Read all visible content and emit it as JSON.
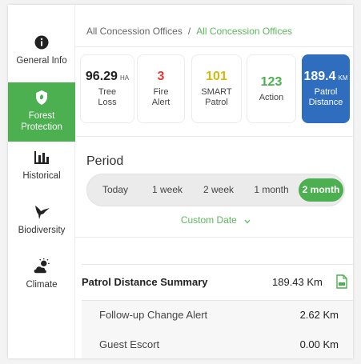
{
  "colors": {
    "accent_green": "#4caf50",
    "patrol_blue": "#2f6dbf",
    "fire_red": "#e53935",
    "smart_yellow": "#d4b80a",
    "action_green": "#4caf50"
  },
  "sidebar": {
    "items": [
      {
        "label": "General Info",
        "icon": "info-icon",
        "active": false
      },
      {
        "label": "Forest\nProtection",
        "icon": "shield-icon",
        "active": true
      },
      {
        "label": "Historical",
        "icon": "bar-chart-icon",
        "active": false
      },
      {
        "label": "Biodiversity",
        "icon": "hummingbird-icon",
        "active": false
      },
      {
        "label": "Climate",
        "icon": "weather-icon",
        "active": false
      }
    ]
  },
  "breadcrumb": {
    "first": "All Concession Offices",
    "separator": "/",
    "second": "All Concession Offices"
  },
  "stats": [
    {
      "value": "96.29",
      "unit": "HA",
      "label": "Tree\nLoss",
      "color": "#222222"
    },
    {
      "value": "3",
      "unit": "",
      "label": "Fire\nAlert",
      "color": "#e53935"
    },
    {
      "value": "101",
      "unit": "",
      "label": "SMART\nPatrol",
      "color": "#d4b80a"
    },
    {
      "value": "123",
      "unit": "",
      "label": "Action",
      "color": "#4caf50"
    },
    {
      "value": "189.4",
      "unit": "KM",
      "label": "Patrol\nDistance",
      "color": "#ffffff"
    }
  ],
  "period": {
    "title": "Period",
    "options": [
      "Today",
      "1 week",
      "2 week",
      "1 month",
      "2 month"
    ],
    "selected": "2 month",
    "custom_date_label": "Custom Date",
    "custom_date_icon": "chevron-down-icon"
  },
  "summary": {
    "title": "Patrol Distance Summary",
    "total": "189.43 Km",
    "export_icon": "document-icon",
    "rows": [
      {
        "label": "Follow-up Change Alert",
        "value": "2.62 Km"
      },
      {
        "label": "Guest Escort",
        "value": "0.00 Km"
      }
    ]
  }
}
